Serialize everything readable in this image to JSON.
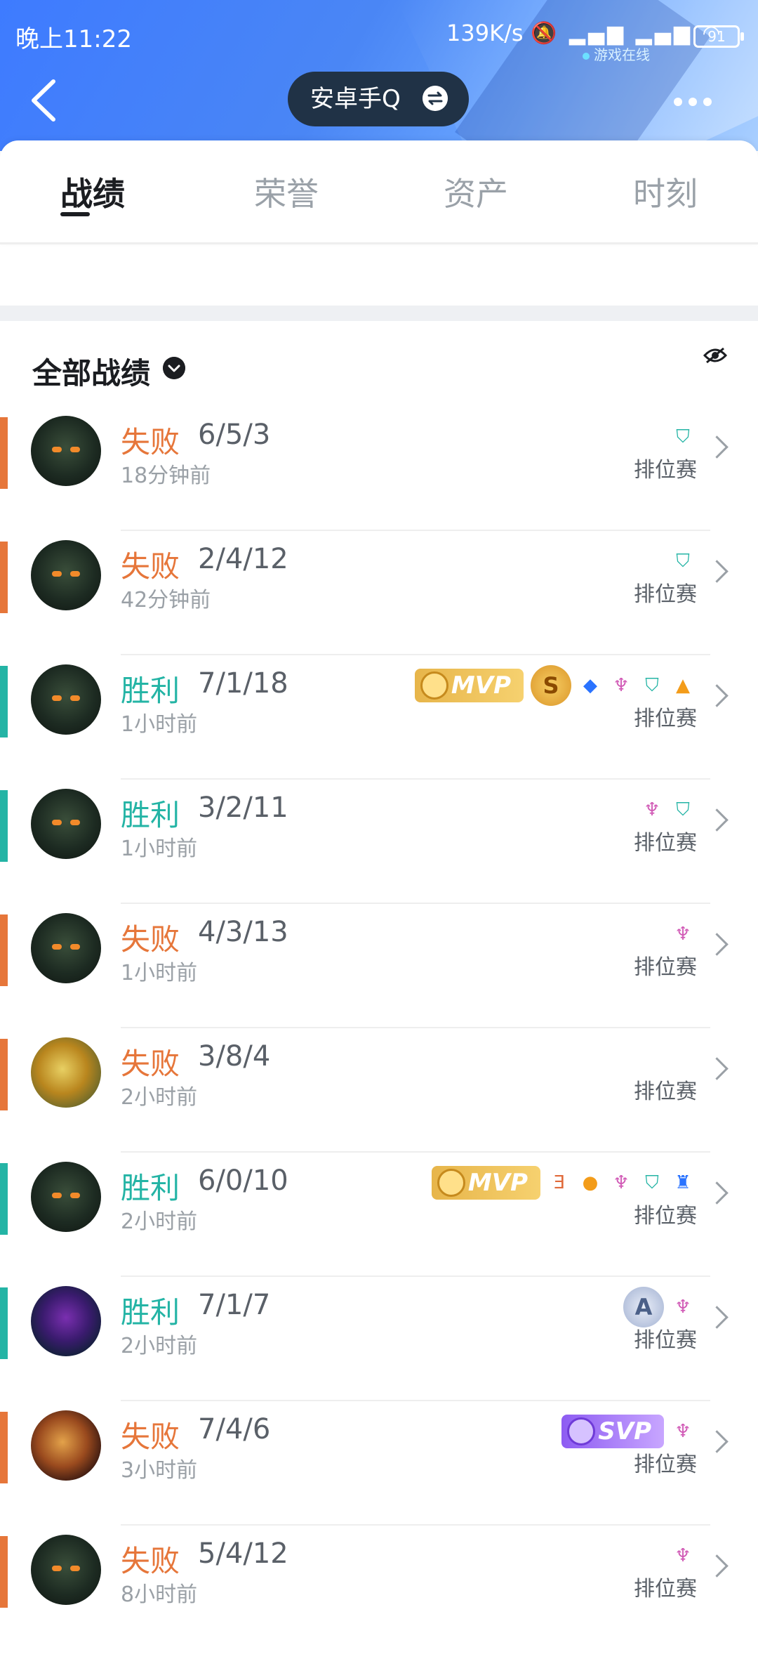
{
  "status_bar": {
    "time": "晚上11:22",
    "network_speed": "139K/s",
    "battery": "91",
    "online_text": "游戏在线"
  },
  "header": {
    "title": "安卓手Q",
    "back_icon": "chevron-left-icon",
    "more_icon": "more-dots-icon",
    "swap_icon": "swap-icon"
  },
  "tabs": [
    {
      "label": "战绩",
      "active": true
    },
    {
      "label": "荣誉",
      "active": false
    },
    {
      "label": "资产",
      "active": false
    },
    {
      "label": "时刻",
      "active": false
    }
  ],
  "section": {
    "title": "全部战绩",
    "hide_icon": "eye-off-icon"
  },
  "records": [
    {
      "result": "失败",
      "outcome": "lose",
      "kda": "6/5/3",
      "ago": "18分钟前",
      "mode": "排位赛",
      "avatar": "dark",
      "badges": [
        {
          "type": "icon",
          "icon": "shield-icon",
          "color": "teal",
          "glyph": "⛉"
        }
      ]
    },
    {
      "result": "失败",
      "outcome": "lose",
      "kda": "2/4/12",
      "ago": "42分钟前",
      "mode": "排位赛",
      "avatar": "dark",
      "badges": [
        {
          "type": "icon",
          "icon": "shield-icon",
          "color": "teal",
          "glyph": "⛉"
        }
      ]
    },
    {
      "result": "胜利",
      "outcome": "win",
      "kda": "7/1/18",
      "ago": "1小时前",
      "mode": "排位赛",
      "avatar": "dark",
      "badges": [
        {
          "type": "mvp",
          "label": "MVP"
        },
        {
          "type": "coin",
          "label": "S"
        },
        {
          "type": "icon",
          "icon": "medal-icon",
          "color": "blue",
          "glyph": "◆"
        },
        {
          "type": "icon",
          "icon": "demon-icon",
          "color": "pink",
          "glyph": "♆"
        },
        {
          "type": "icon",
          "icon": "shield-icon",
          "color": "teal",
          "glyph": "⛉"
        },
        {
          "type": "icon",
          "icon": "coins-up-icon",
          "color": "orange",
          "glyph": "▲"
        }
      ]
    },
    {
      "result": "胜利",
      "outcome": "win",
      "kda": "3/2/11",
      "ago": "1小时前",
      "mode": "排位赛",
      "avatar": "dark",
      "badges": [
        {
          "type": "icon",
          "icon": "demon-icon",
          "color": "pink",
          "glyph": "♆"
        },
        {
          "type": "icon",
          "icon": "shield-icon",
          "color": "teal",
          "glyph": "⛉"
        }
      ]
    },
    {
      "result": "失败",
      "outcome": "lose",
      "kda": "4/3/13",
      "ago": "1小时前",
      "mode": "排位赛",
      "avatar": "dark",
      "badges": [
        {
          "type": "icon",
          "icon": "demon-icon",
          "color": "pink",
          "glyph": "♆"
        }
      ]
    },
    {
      "result": "失败",
      "outcome": "lose",
      "kda": "3/8/4",
      "ago": "2小时前",
      "mode": "排位赛",
      "avatar": "gold",
      "badges": []
    },
    {
      "result": "胜利",
      "outcome": "win",
      "kda": "6/0/10",
      "ago": "2小时前",
      "mode": "排位赛",
      "avatar": "dark",
      "badges": [
        {
          "type": "mvp",
          "label": "MVP"
        },
        {
          "type": "icon",
          "icon": "triple-kill-icon",
          "color": "red",
          "glyph": "Ǝ"
        },
        {
          "type": "icon",
          "icon": "gold-coins-icon",
          "color": "orange",
          "glyph": "●"
        },
        {
          "type": "icon",
          "icon": "demon-icon",
          "color": "pink",
          "glyph": "♆"
        },
        {
          "type": "icon",
          "icon": "shield-icon",
          "color": "teal",
          "glyph": "⛉"
        },
        {
          "type": "icon",
          "icon": "tower-icon",
          "color": "blue",
          "glyph": "♜"
        }
      ]
    },
    {
      "result": "胜利",
      "outcome": "win",
      "kda": "7/1/7",
      "ago": "2小时前",
      "mode": "排位赛",
      "avatar": "purple",
      "badges": [
        {
          "type": "rank",
          "label": "A"
        },
        {
          "type": "icon",
          "icon": "demon-icon",
          "color": "pink",
          "glyph": "♆"
        }
      ]
    },
    {
      "result": "失败",
      "outcome": "lose",
      "kda": "7/4/6",
      "ago": "3小时前",
      "mode": "排位赛",
      "avatar": "knight",
      "badges": [
        {
          "type": "svp",
          "label": "SVP"
        },
        {
          "type": "icon",
          "icon": "demon-icon",
          "color": "pink",
          "glyph": "♆"
        }
      ]
    },
    {
      "result": "失败",
      "outcome": "lose",
      "kda": "5/4/12",
      "ago": "8小时前",
      "mode": "排位赛",
      "avatar": "dark",
      "badges": [
        {
          "type": "icon",
          "icon": "demon-icon",
          "color": "pink",
          "glyph": "♆"
        }
      ]
    }
  ],
  "colors": {
    "lose": "#e6763a",
    "win": "#24b4a5",
    "header_blue": "#3e7bff"
  }
}
